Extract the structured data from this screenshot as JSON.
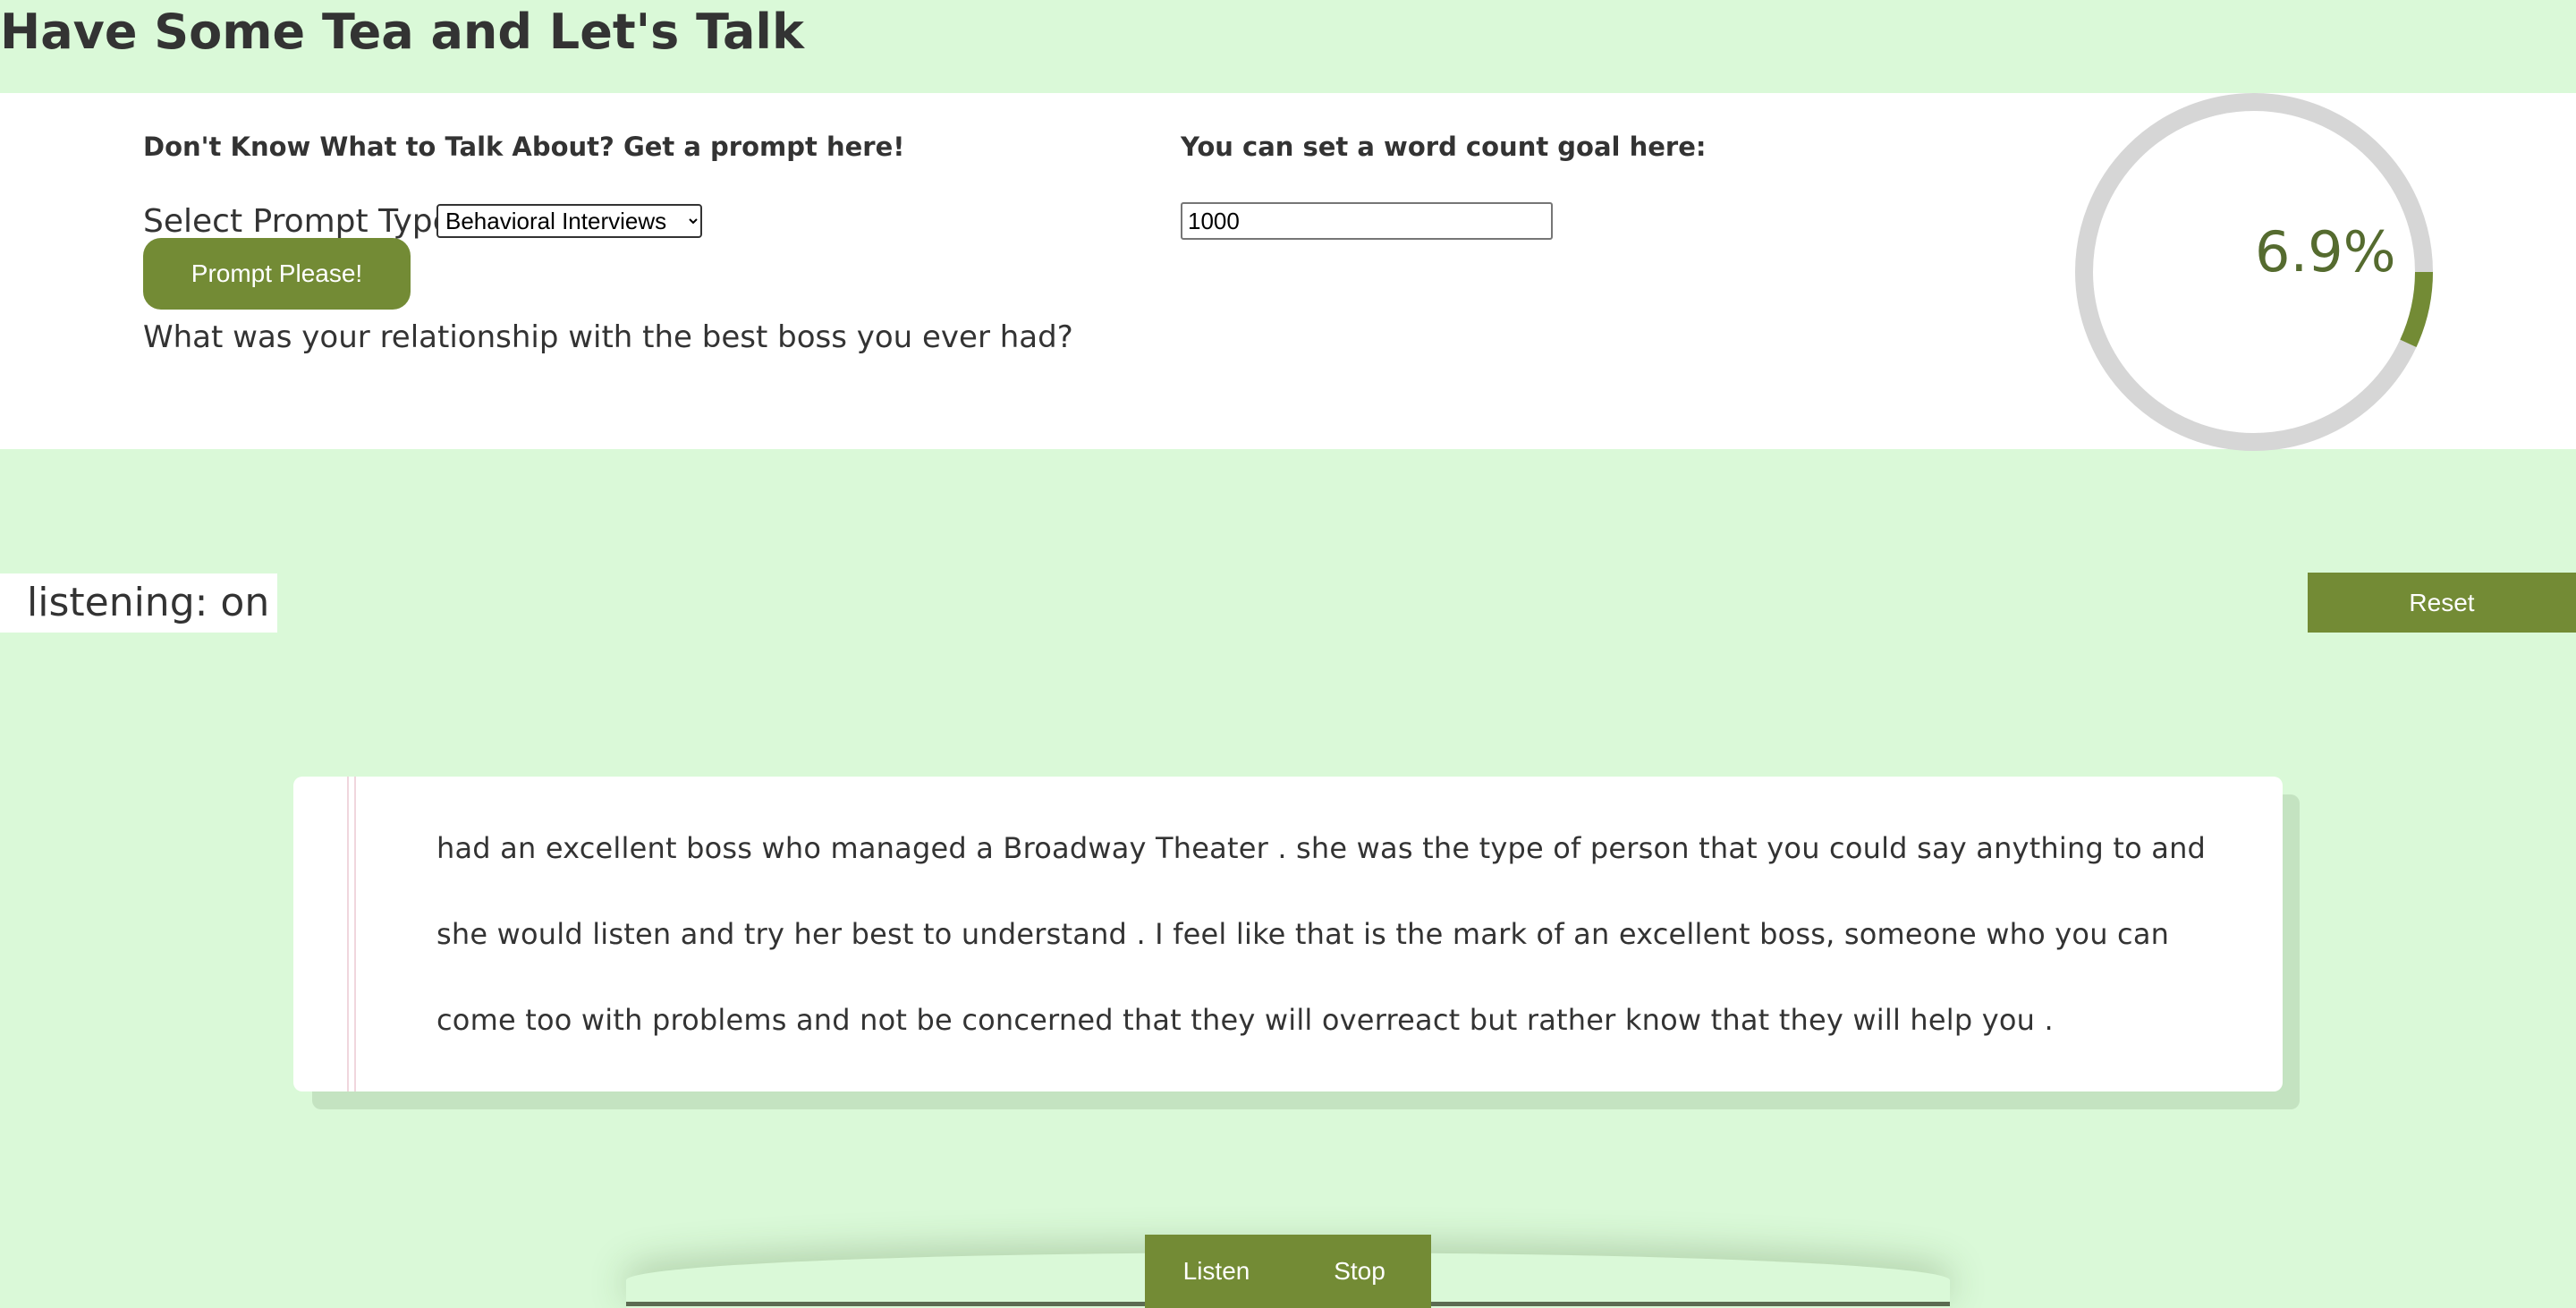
{
  "header": {
    "title": "Have Some Tea and Let's Talk"
  },
  "prompt_section": {
    "heading": "Don't Know What to Talk About? Get a prompt here!",
    "select_label": "Select Prompt Type:",
    "select_options": [
      "Behavioral Interviews"
    ],
    "selected_option": "Behavioral Interviews",
    "button_label": "Prompt Please!",
    "current_prompt": "What was your relationship with the best boss you ever had?"
  },
  "goal_section": {
    "heading": "You can set a word count goal here:",
    "word_goal_value": "1000"
  },
  "progress": {
    "percent_label": "6.9%",
    "fraction": 0.069,
    "track_color": "#d6d6d6",
    "fill_color": "#738b35",
    "text_color": "#556b2f"
  },
  "status": {
    "listening_label": "listening: on"
  },
  "reset_button": {
    "label": "Reset"
  },
  "transcript": {
    "lines": [
      "had an excellent boss who managed a Broadway Theater . she was the type of person that you could say anything to and",
      "she would listen and try her best to understand . I feel like that is the mark of an excellent boss, someone who you can",
      "come too with problems and not be concerned that they will overreact but rather know that they will help you ."
    ]
  },
  "controls": {
    "listen_label": "Listen",
    "stop_label": "Stop"
  },
  "colors": {
    "page_background": "#daf9d8",
    "accent": "#738b35",
    "panel": "#ffffff",
    "text": "#333333"
  }
}
